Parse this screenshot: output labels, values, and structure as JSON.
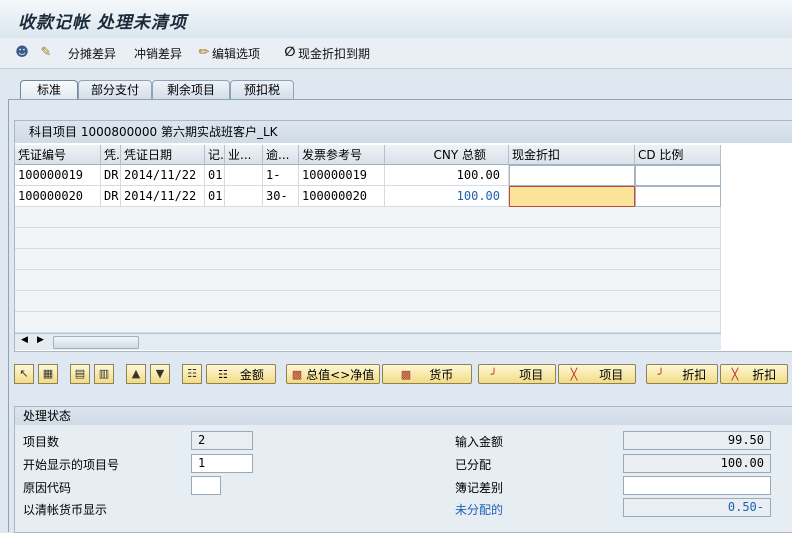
{
  "window": {
    "title": "收款记帐 处理未清项"
  },
  "toolbar": {
    "items": [
      {
        "label": "分摊差异",
        "icon": "split-icon"
      },
      {
        "label": "冲销差异",
        "icon": "writeoff-icon"
      },
      {
        "label": "编辑选项",
        "icon": "pencil-icon"
      },
      {
        "label": "现金折扣到期",
        "icon": "null-icon"
      }
    ]
  },
  "tabs": [
    "标准",
    "部分支付",
    "剩余项目",
    "预扣税"
  ],
  "table": {
    "caption": "科目项目 1000800000 第六期实战班客户_LK",
    "columns": [
      "凭证编号",
      "凭.",
      "凭证日期",
      "记.",
      "业...",
      "逾...",
      "发票参考号",
      "CNY 总额",
      "现金折扣",
      "CD 比例"
    ],
    "rows": [
      [
        "100000019",
        "DR",
        "2014/11/22",
        "01",
        "",
        "1-",
        "100000019",
        "100.00",
        "",
        ""
      ],
      [
        "100000020",
        "DR",
        "2014/11/22",
        "01",
        "",
        "30-",
        "100000020",
        "100.00",
        "",
        ""
      ]
    ]
  },
  "buttons": {
    "amount": "金额",
    "gross_net": "总值<>净值",
    "currency": "货币",
    "items1": "项目",
    "items2": "项目",
    "discount1": "折扣",
    "discount2": "折扣"
  },
  "status": {
    "caption": "处理状态",
    "item_count_label": "项目数",
    "item_count": "2",
    "first_item_label": "开始显示的项目号",
    "first_item": "1",
    "reason_code_label": "原因代码",
    "reason_code": "",
    "clearing_currency_label": "以清帐货币显示",
    "entered_label": "输入金额",
    "entered": "99.50",
    "assigned_label": "已分配",
    "assigned": "100.00",
    "diff_label": "簿记差别",
    "diff": "",
    "unassigned_label": "未分配的",
    "unassigned": "0.50-"
  },
  "colors": {
    "accent_blue": "#1f5fb4",
    "button_yellow": "#f3dc83",
    "focus_yellow": "#fbe49a"
  }
}
